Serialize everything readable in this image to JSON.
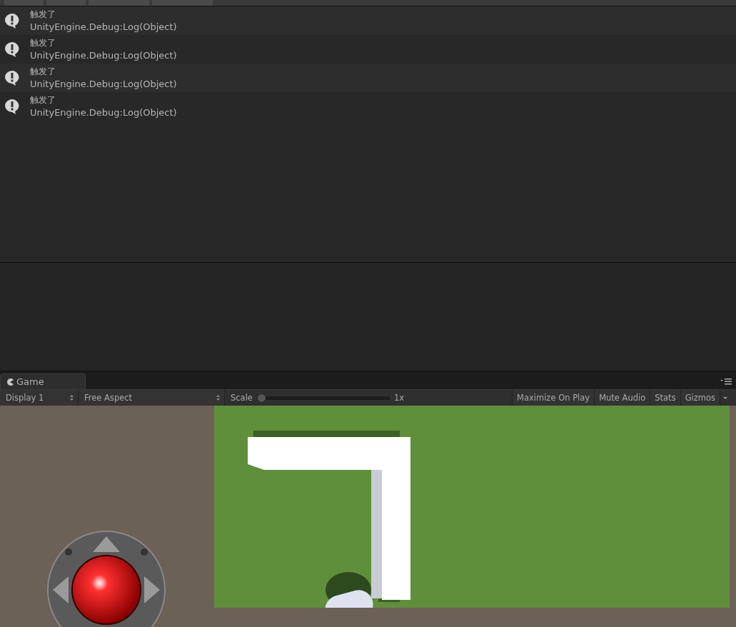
{
  "console": {
    "entries": [
      {
        "message": "触发了",
        "stack": "UnityEngine.Debug:Log(Object)"
      },
      {
        "message": "触发了",
        "stack": "UnityEngine.Debug:Log(Object)"
      },
      {
        "message": "触发了",
        "stack": "UnityEngine.Debug:Log(Object)"
      },
      {
        "message": "触发了",
        "stack": "UnityEngine.Debug:Log(Object)"
      }
    ]
  },
  "game": {
    "tab": {
      "label": "Game"
    },
    "toolbar": {
      "display": "Display 1",
      "aspect": "Free Aspect",
      "scale_label": "Scale",
      "scale": {
        "level": 0
      },
      "scale_value": "1x",
      "buttons": [
        "Maximize On Play",
        "Mute Audio",
        "Stats",
        "Gizmos"
      ]
    }
  }
}
